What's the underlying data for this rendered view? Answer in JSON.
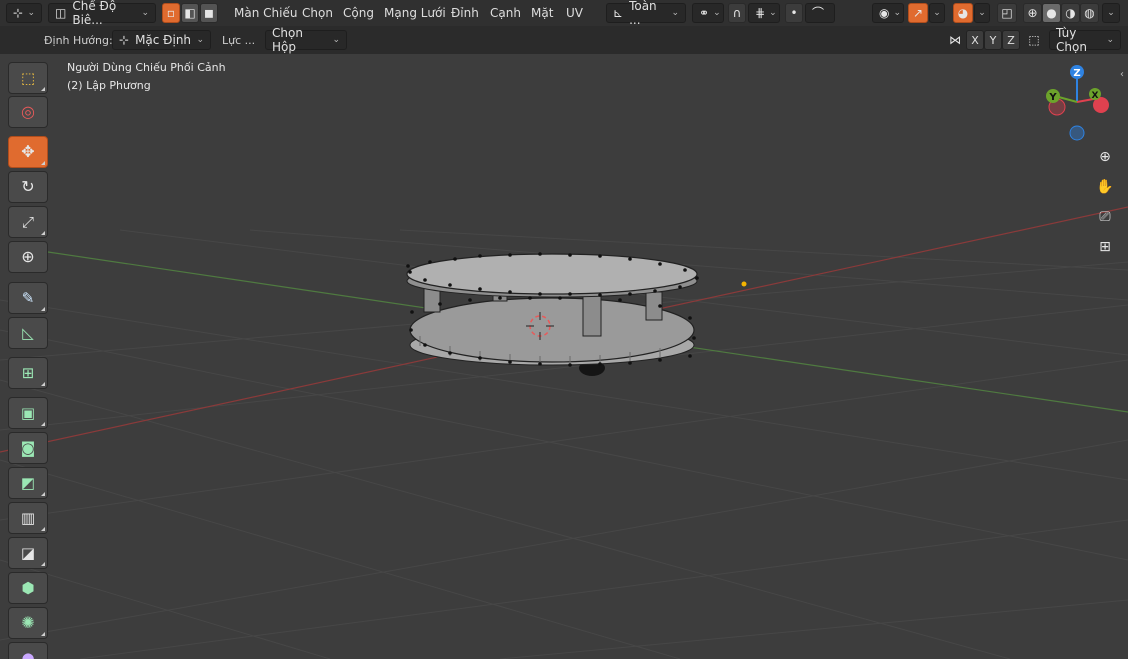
{
  "header": {
    "mode_dropdown": "Chế Độ Biê...",
    "menus": [
      "Màn Chiếu",
      "Chọn",
      "Cộng",
      "Mạng Lưới",
      "Đỉnh",
      "Cạnh",
      "Mặt",
      "UV"
    ],
    "transform_pivot": "Toàn ...",
    "orientation_label": "Định Hướng:",
    "orientation_value": "Mặc Định",
    "drag_label": "Lực ...",
    "drag_value": "Chọn Hộp",
    "axes": [
      "X",
      "Y",
      "Z"
    ],
    "options_label": "Tùy Chọn"
  },
  "viewport": {
    "view_name": "Người Dùng Chiếu Phối Cảnh",
    "object_name": "(2) Lập Phương"
  },
  "gizmo": {
    "x": "X",
    "y": "Y",
    "z": "Z",
    "colors": {
      "x": "#e0414f",
      "y": "#6ca32b",
      "z": "#2f83e2"
    }
  },
  "tools": [
    "select-box-tool",
    "cursor-tool",
    "move-tool",
    "rotate-tool",
    "scale-tool",
    "transform-tool",
    "annotate-tool",
    "measure-tool",
    "add-cube-tool",
    "extrude-tool",
    "inset-tool",
    "bevel-tool",
    "loop-cut-tool",
    "knife-tool",
    "poly-build-tool",
    "spin-tool",
    "smooth-tool"
  ],
  "colors": {
    "accent": "#e06b2f",
    "viewport_bg": "#3d3d3d",
    "header_bg": "#303030",
    "mesh_vertex": "#111111",
    "origin_dot": "#f5b400"
  }
}
